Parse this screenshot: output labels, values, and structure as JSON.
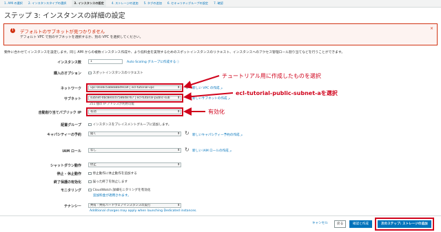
{
  "steps": [
    "1. AMI の選択",
    "2. インスタンスタイプの選択",
    "3. インスタンスの設定",
    "4. ストレージの追加",
    "5. タグの追加",
    "6. セキュリティグループの設定",
    "7. 確認"
  ],
  "heading": "ステップ 3: インスタンスの詳細の設定",
  "alert": {
    "title": "デフォルトのサブネットが見つかりません",
    "body": "デフォルト VPC で別のサブネットを選択するか、別の VPC を選択してください。",
    "close": "×"
  },
  "description": "要件に合わせてインスタンスを設定します。同じ AMI からの複数インスタンス作成や、より低料金を実現するためのスポットインスタンスのリクエスト、インスタンスへのアクセス管理ロール割り当てなどを行うことができます。",
  "form": {
    "instance_count": {
      "label": "インスタンス数",
      "value": "1",
      "link": "Auto Scaling グループに作成する"
    },
    "purchase_option": {
      "label": "購入のオプション",
      "checkbox": "スポットインスタンスのリクエスト"
    },
    "network": {
      "label": "ネットワーク",
      "value": "vpc-0ea6c5ab8abb49ca9 | ecl-tutorial-vpc",
      "link": "新しい VPC の作成"
    },
    "subnet": {
      "label": "サブネット",
      "value": "subnet-0bc8e0cd7586d8767 | ecl-tutorial-public-sub",
      "link": "新しいサブネットの作成",
      "note": "251 個の IP アドレスが利用可能"
    },
    "auto_ip": {
      "label": "自動割り当てパブリック IP",
      "value": "有効"
    },
    "placement": {
      "label": "配置グループ",
      "checkbox": "インスタンスをプレイスメントグループに追加します。"
    },
    "capacity": {
      "label": "キャパシティーの予約",
      "value": "開く",
      "link": "新しいキャパシティー予約の作成"
    },
    "iam_role": {
      "label": "IAM ロール",
      "value": "なし",
      "link": "新しい IAM ロールの作成"
    },
    "shutdown": {
      "label": "シャットダウン動作",
      "value": "停止"
    },
    "stop_hibernate": {
      "label": "停止 - 休止動作",
      "checkbox": "停止動作に休止動作を追加する"
    },
    "termination": {
      "label": "終了保護の有効化",
      "checkbox": "誤った終了を防止します"
    },
    "monitoring": {
      "label": "モニタリング",
      "checkbox": "CloudWatch 詳細モニタリングを有効化",
      "note": "追加料金が適用されます。"
    },
    "tenancy": {
      "label": "テナンシー",
      "value": "共有 - 共有ハードウェアインスタンスの実行",
      "note": "Additional charges may apply when launching Dedicated instances."
    }
  },
  "annotations": {
    "network": "チュートリアル用に作成したものを選択",
    "subnet": "ecl-tutorial-public-subnet-aを選択",
    "auto_ip": "有効化",
    "color": "#d0021b"
  },
  "buttons": {
    "cancel": "キャンセル",
    "back": "戻る",
    "review": "確認と作成",
    "next": "次のステップ: ストレージの追加"
  },
  "icons": {
    "refresh": "refresh-icon",
    "external": "external-link-icon",
    "alert": "error-icon"
  }
}
